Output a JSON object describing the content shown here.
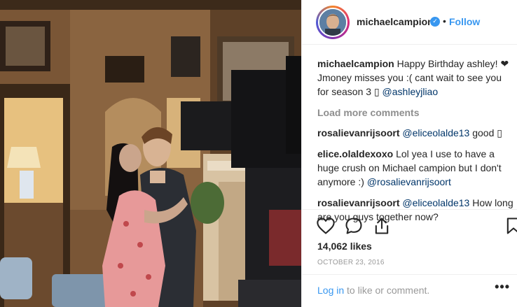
{
  "post": {
    "username": "michaelcampion",
    "verified_icon": "verified-badge-icon",
    "separator": "•",
    "follow_label": "Follow"
  },
  "caption": {
    "username": "michaelcampion",
    "text": "Happy Birthday ashley! ❤ Jmoney misses you :( cant wait to see you for season 3 ▯",
    "mention": "@ashleyjliao"
  },
  "load_more": "Load more comments",
  "comments": [
    {
      "username": "rosalievanrijsoort",
      "mention": "@eliceolalde13",
      "text": "good ▯"
    },
    {
      "username": "elice.olaldexoxo",
      "text": "Lol yea I use to have a huge crush on Michael campion but I don't anymore :)",
      "mention": "@rosalievanrijsoort"
    },
    {
      "username": "rosalievanrijsoort",
      "mention": "@eliceolalde13",
      "text": "How long are you guys together now?"
    }
  ],
  "likes": "14,062 likes",
  "date": "OCTOBER 23, 2016",
  "footer": {
    "login": "Log in",
    "rest": "to like or comment.",
    "more": "•••"
  },
  "icons": [
    "heart-icon",
    "comment-icon",
    "share-icon",
    "bookmark-icon"
  ],
  "colors": {
    "link": "#3897f0",
    "text": "#262626",
    "muted": "#999999"
  }
}
